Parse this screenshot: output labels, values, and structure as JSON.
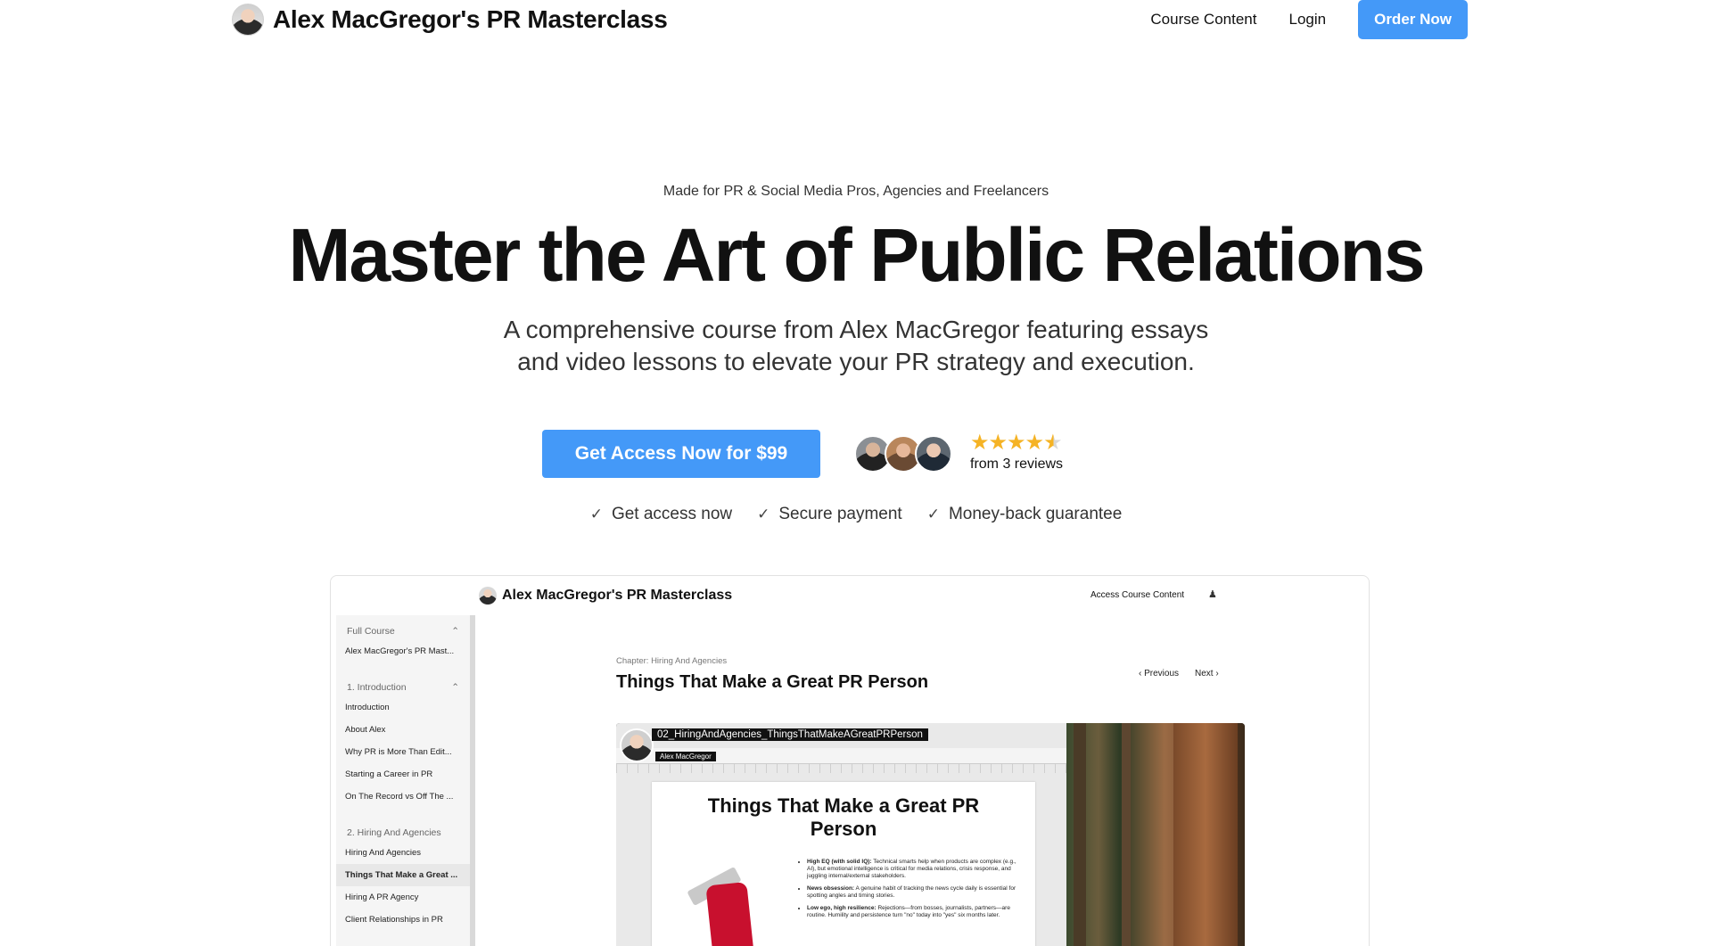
{
  "header": {
    "brand_title": "Alex MacGregor's PR Masterclass",
    "nav": [
      {
        "label": "Course Content"
      },
      {
        "label": "Login"
      }
    ],
    "order_button": "Order Now"
  },
  "hero": {
    "eyebrow": "Made for PR & Social Media Pros, Agencies and Freelancers",
    "headline": "Master the Art of Public Relations",
    "subhead_line1": "A comprehensive course from Alex MacGregor featuring essays",
    "subhead_line2": "and video lessons to elevate your PR strategy and execution.",
    "cta": "Get Access Now for $99",
    "rating_stars": 4.5,
    "reviews_text": "from 3 reviews",
    "perks": [
      "Get access now",
      "Secure payment",
      "Money-back guarantee"
    ],
    "star_color": "#f5b325",
    "accent_color": "#4499f8"
  },
  "preview": {
    "brand_title": "Alex MacGregor's PR Masterclass",
    "access_link": "Access Course Content",
    "sidebar": {
      "full_course_header": "Full Course",
      "course_item": "Alex MacGregor's PR Mast...",
      "section1_header": "1. Introduction",
      "section1_items": [
        "Introduction",
        "About Alex",
        "Why PR is More Than Edit...",
        "Starting a Career in PR",
        "On The Record vs Off The ..."
      ],
      "section2_header": "2. Hiring And Agencies",
      "section2_items": [
        "Hiring And Agencies",
        "Things That Make a Great ...",
        "Hiring A PR Agency",
        "Client Relationships in PR"
      ]
    },
    "chapter": "Chapter: Hiring And Agencies",
    "lesson_title": "Things That Make a Great PR Person",
    "previous": "Previous",
    "next": "Next",
    "video": {
      "file_tag": "02_HiringAndAgencies_ThingsThatMakeAGreatPRPerson",
      "presenter_name": "Alex MacGregor",
      "slide_title": "Things That Make a Great PR Person",
      "bullets": [
        {
          "bold": "High EQ (with solid IQ):",
          "text": " Technical smarts help when products are complex (e.g., AI), but emotional intelligence is critical for media relations, crisis response, and juggling internal/external stakeholders."
        },
        {
          "bold": "News obsession:",
          "text": " A genuine habit of tracking the news cycle daily is essential for spotting angles and timing stories."
        },
        {
          "bold": "Low ego, high resilience:",
          "text": " Rejections—from bosses, journalists, partners—are routine. Humility and persistence turn \"no\" today into \"yes\" six months later."
        }
      ]
    }
  }
}
